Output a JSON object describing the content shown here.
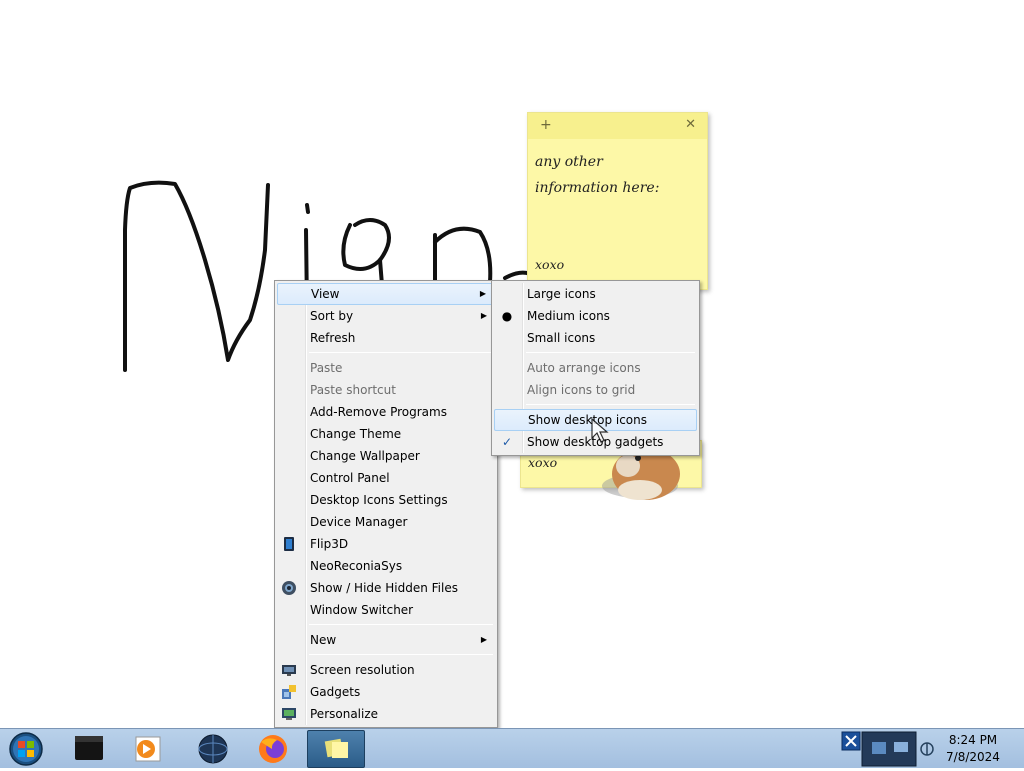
{
  "desktop": {
    "note_top": {
      "lines": [
        "any other",
        "information here:"
      ],
      "footer": "xoxo"
    },
    "note_bottom": {
      "footer": "xoxo"
    }
  },
  "context_menu": {
    "items": [
      {
        "label": "View",
        "submenu": true,
        "highlighted": true
      },
      {
        "label": "Sort by",
        "submenu": true
      },
      {
        "label": "Refresh"
      },
      {
        "label": "Paste",
        "disabled": true
      },
      {
        "label": "Paste shortcut",
        "disabled": true
      },
      {
        "label": "Add-Remove Programs"
      },
      {
        "label": "Change Theme"
      },
      {
        "label": "Change Wallpaper"
      },
      {
        "label": "Control Panel"
      },
      {
        "label": "Desktop Icons Settings"
      },
      {
        "label": "Device Manager"
      },
      {
        "label": "Flip3D",
        "icon": "flip3d-icon"
      },
      {
        "label": "NeoReconiaSys"
      },
      {
        "label": "Show / Hide Hidden Files",
        "icon": "globe-icon"
      },
      {
        "label": "Window Switcher"
      },
      {
        "label": "New",
        "submenu": true
      },
      {
        "label": "Screen resolution",
        "icon": "display-icon"
      },
      {
        "label": "Gadgets",
        "icon": "gadgets-icon"
      },
      {
        "label": "Personalize",
        "icon": "personalize-icon"
      }
    ]
  },
  "view_submenu": {
    "items": [
      {
        "label": "Large icons"
      },
      {
        "label": "Medium icons",
        "mark": "radio"
      },
      {
        "label": "Small icons"
      },
      {
        "label": "Auto arrange icons",
        "disabled": true
      },
      {
        "label": "Align icons to grid",
        "disabled": true
      },
      {
        "label": "Show desktop icons",
        "highlighted": true
      },
      {
        "label": "Show desktop gadgets",
        "mark": "check"
      }
    ]
  },
  "taskbar": {
    "start": {
      "icon": "windows-start-icon"
    },
    "pinned": [
      {
        "icon": "black-app-icon"
      },
      {
        "icon": "media-player-icon"
      },
      {
        "icon": "globe-app-icon"
      },
      {
        "icon": "firefox-icon"
      },
      {
        "icon": "sticky-notes-icon",
        "active": true
      }
    ],
    "clock": {
      "time": "8:24 PM",
      "date": "7/8/2024"
    }
  },
  "colors": {
    "note_yellow": "#fdf8a7",
    "menu_bg": "#f0f0f0",
    "highlight": "#dcebfc",
    "taskbar": "#b9d1ea"
  }
}
